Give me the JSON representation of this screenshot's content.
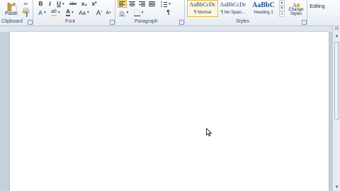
{
  "clipboard": {
    "paste_label": "Paste",
    "group_label": "Clipboard"
  },
  "font": {
    "group_label": "Font",
    "row1": {
      "bold": "B",
      "italic": "I",
      "underline": "U",
      "strike": "abc",
      "subscript": "x₂",
      "superscript": "x²"
    },
    "row2": {
      "effects": "A",
      "highlight": "ab",
      "color": "A",
      "change_case": "Aa",
      "grow": "A",
      "shrink": "A"
    }
  },
  "paragraph": {
    "group_label": "Paragraph",
    "pilcrow": "¶"
  },
  "styles": {
    "group_label": "Styles",
    "items": [
      {
        "preview": "AaBbCcDc",
        "name": "¶ Normal"
      },
      {
        "preview": "AaBbCcDc",
        "name": "¶ No Spaci..."
      },
      {
        "preview": "AaBbC",
        "name": "Heading 1"
      }
    ],
    "change_styles_line1": "Change",
    "change_styles_line2": "Styles"
  },
  "editing": {
    "label": "Editing"
  },
  "colors": {
    "highlight": "#f2e21a",
    "font_color": "#d81e1e",
    "selected_fill": "#ffe7a2"
  }
}
